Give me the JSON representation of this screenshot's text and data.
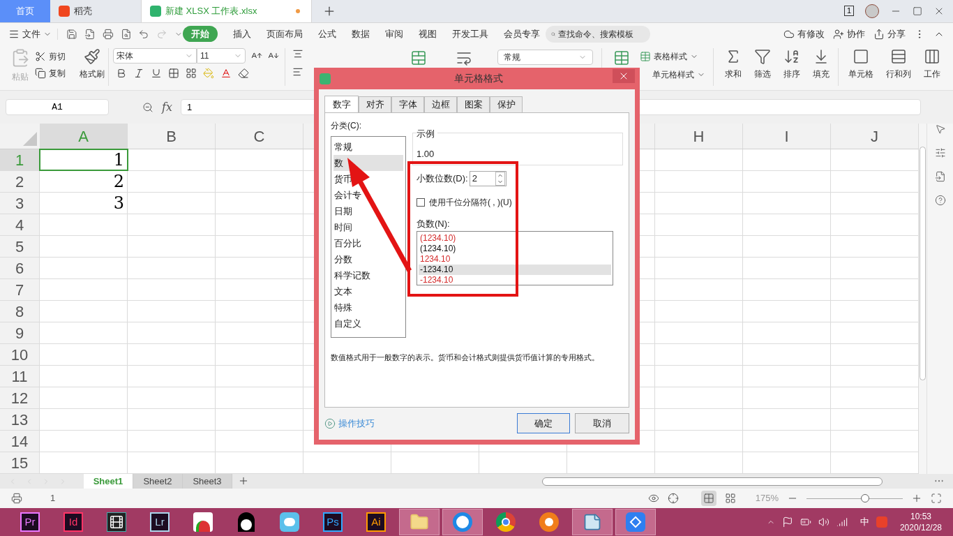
{
  "app_tabs": [
    {
      "label": "首页",
      "selected": false,
      "kind": "home"
    },
    {
      "label": "稻壳",
      "selected": false,
      "kind": "docer"
    },
    {
      "label": "新建 XLSX 工作表.xlsx",
      "selected": true,
      "kind": "sheet",
      "modified": true
    }
  ],
  "window_badge": "1",
  "menu": {
    "file": "文件",
    "items": [
      {
        "label": "开始",
        "selected": true
      },
      {
        "label": "插入",
        "selected": false
      },
      {
        "label": "页面布局",
        "selected": false
      },
      {
        "label": "公式",
        "selected": false
      },
      {
        "label": "数据",
        "selected": false
      },
      {
        "label": "审阅",
        "selected": false
      },
      {
        "label": "视图",
        "selected": false
      },
      {
        "label": "开发工具",
        "selected": false
      },
      {
        "label": "会员专享",
        "selected": false
      }
    ],
    "search": {
      "placeholder": "查找命令、搜索模板"
    },
    "actions": [
      {
        "label": "有修改",
        "kind": "cloud"
      },
      {
        "label": "协作",
        "kind": "people"
      },
      {
        "label": "分享",
        "kind": "share"
      }
    ]
  },
  "ribbon": {
    "paste": "粘贴",
    "cut": "剪切",
    "copy": "复制",
    "brush": "格式刷",
    "font": "宋体",
    "size": "11",
    "number_format": "常规",
    "table_style": "表格样式",
    "cell_style": "单元格样式",
    "tools": [
      {
        "label": "求和",
        "kind": "sum"
      },
      {
        "label": "筛选",
        "kind": "filter"
      },
      {
        "label": "排序",
        "kind": "sort"
      },
      {
        "label": "填充",
        "kind": "fill"
      }
    ],
    "tools2": [
      {
        "label": "单元格",
        "kind": "cell"
      },
      {
        "label": "行和列",
        "kind": "rows"
      },
      {
        "label": "工作",
        "kind": "sheet"
      }
    ]
  },
  "formula_bar": {
    "name_box": "A1",
    "fx": "fx",
    "value": "1"
  },
  "sheet": {
    "columns_left": [
      {
        "label": "A",
        "selected": true
      },
      {
        "label": "B",
        "selected": false
      },
      {
        "label": "C",
        "selected": false
      }
    ],
    "columns_right": [
      {
        "label": "H",
        "selected": false
      },
      {
        "label": "I",
        "selected": false
      },
      {
        "label": "J",
        "selected": false
      }
    ],
    "rows": [
      {
        "label": "1",
        "selected": true,
        "value": "1"
      },
      {
        "label": "2",
        "selected": false,
        "value": "2"
      },
      {
        "label": "3",
        "selected": false,
        "value": "3"
      },
      {
        "label": "4",
        "selected": false
      },
      {
        "label": "5",
        "selected": false
      },
      {
        "label": "6",
        "selected": false
      },
      {
        "label": "7",
        "selected": false
      },
      {
        "label": "8",
        "selected": false
      },
      {
        "label": "9",
        "selected": false
      },
      {
        "label": "10",
        "selected": false
      },
      {
        "label": "11",
        "selected": false
      },
      {
        "label": "12",
        "selected": false
      },
      {
        "label": "13",
        "selected": false
      },
      {
        "label": "14",
        "selected": false
      },
      {
        "label": "15",
        "selected": false
      }
    ]
  },
  "sheet_tabs": [
    {
      "label": "Sheet1",
      "selected": true
    },
    {
      "label": "Sheet2",
      "selected": false
    },
    {
      "label": "Sheet3",
      "selected": false
    }
  ],
  "status_bar": {
    "cell_value": "1",
    "zoom": "175%",
    "zoom_slider": {
      "level": 0.61
    }
  },
  "dialog": {
    "title": "单元格格式",
    "tabs": [
      {
        "label": "数字",
        "selected": true
      },
      {
        "label": "对齐",
        "selected": false
      },
      {
        "label": "字体",
        "selected": false
      },
      {
        "label": "边框",
        "selected": false
      },
      {
        "label": "图案",
        "selected": false
      },
      {
        "label": "保护",
        "selected": false
      }
    ],
    "category_label": "分类(C):",
    "categories": [
      {
        "label": "常规",
        "selected": false
      },
      {
        "label": "数",
        "selected": true
      },
      {
        "label": "货币",
        "selected": false
      },
      {
        "label": "会计专",
        "selected": false
      },
      {
        "label": "日期",
        "selected": false
      },
      {
        "label": "时间",
        "selected": false
      },
      {
        "label": "百分比",
        "selected": false
      },
      {
        "label": "分数",
        "selected": false
      },
      {
        "label": "科学记数",
        "selected": false
      },
      {
        "label": "文本",
        "selected": false
      },
      {
        "label": "特殊",
        "selected": false
      },
      {
        "label": "自定义",
        "selected": false
      }
    ],
    "sample_label": "示例",
    "sample_value": "1.00",
    "decimals_label": "小数位数(D):",
    "decimals_value": "2",
    "separator": {
      "label": "使用千位分隔符( , )(U)",
      "checked": false
    },
    "negative_label": "负数(N):",
    "negatives": [
      {
        "label": "(1234.10)",
        "color": "#d42b2b",
        "selected": false
      },
      {
        "label": "(1234.10)",
        "color": "#111111",
        "selected": false
      },
      {
        "label": "1234.10",
        "color": "#d42b2b",
        "selected": false
      },
      {
        "label": "-1234.10",
        "color": "#111111",
        "selected": true
      },
      {
        "label": "-1234.10",
        "color": "#d42b2b",
        "selected": false
      }
    ],
    "description": "数值格式用于一般数字的表示。货币和会计格式则提供货币值计算的专用格式。",
    "tips_link": "操作技巧",
    "ok": "确定",
    "cancel": "取消"
  },
  "taskbar": {
    "apps": [
      {
        "kind": "badge",
        "label": "Pr",
        "color": "#ea77ff",
        "open": false
      },
      {
        "kind": "badge",
        "label": "Id",
        "color": "#ff3366",
        "open": false
      },
      {
        "kind": "film",
        "open": false
      },
      {
        "kind": "badge",
        "label": "Lr",
        "color": "#add5ec",
        "open": false
      },
      {
        "kind": "chart",
        "open": false
      },
      {
        "kind": "penguin",
        "open": false
      },
      {
        "kind": "rabbit",
        "open": false
      },
      {
        "kind": "badge",
        "label": "Ps",
        "color": "#31a8ff",
        "open": false
      },
      {
        "kind": "badge",
        "label": "Ai",
        "color": "#ff9a00",
        "open": false
      },
      {
        "kind": "folder",
        "open": true
      },
      {
        "kind": "browser",
        "open": true
      },
      {
        "kind": "globe",
        "open": false
      },
      {
        "kind": "cat",
        "open": false
      },
      {
        "kind": "notepad",
        "open": true
      },
      {
        "kind": "wps",
        "open": true
      }
    ],
    "ime": "中",
    "time": "10:53",
    "date": "2020/12/28"
  }
}
